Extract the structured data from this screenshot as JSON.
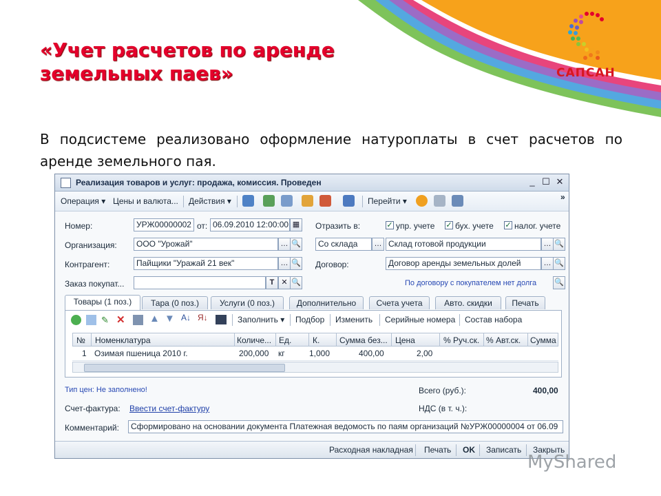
{
  "slide": {
    "title_line1": "«Учет расчетов по аренде",
    "title_line2": "земельных паев»",
    "subtitle": "В подсистеме реализовано оформление натуроплаты в счет расчетов по аренде земельного пая.",
    "logo_text": "САПСАН",
    "watermark": "MyShared"
  },
  "window": {
    "title": "Реализация товаров и услуг: продажа, комиссия. Проведен",
    "controls": {
      "minimize": "_",
      "maximize": "☐",
      "close": "✕"
    },
    "toolbar": {
      "operation": "Операция ▾",
      "prices": "Цены и валюта...",
      "actions": "Действия ▾",
      "goto": "Перейти ▾",
      "more": "»"
    },
    "fields": {
      "number_label": "Номер:",
      "number_value": "УРЖ00000002",
      "from_label": "от:",
      "date_value": "06.09.2010 12:00:00",
      "reflect_label": "Отразить в:",
      "chk_mgmt": "упр. учете",
      "chk_acc": "бух. учете",
      "chk_tax": "налог. учете",
      "org_label": "Организация:",
      "org_value": "ООО \"Урожай\"",
      "from_stock": "Со склада",
      "warehouse_value": "Склад готовой продукции",
      "contractor_label": "Контрагент:",
      "contractor_value": "Пайщики \"Уражай 21 век\"",
      "contract_label": "Договор:",
      "contract_value": "Договор аренды земельных долей",
      "order_label": "Заказ покупат...",
      "order_value": "",
      "order_hint": "По договору с покупателем нет долга"
    },
    "tabs": [
      "Товары (1 поз.)",
      "Тара (0 поз.)",
      "Услуги (0 поз.)",
      "Дополнительно",
      "Счета учета",
      "Авто. скидки",
      "Печать"
    ],
    "grid_toolbar": {
      "fill": "Заполнить ▾",
      "select": "Подбор",
      "change": "Изменить",
      "serials": "Серийные номера",
      "set": "Состав набора"
    },
    "grid_headers": [
      "№",
      "Номенклатура",
      "Количе...",
      "Ед.",
      "К.",
      "Сумма без...",
      "Цена",
      "% Руч.ск.",
      "% Авт.ск.",
      "Сумма"
    ],
    "grid_rows": [
      {
        "num": "1",
        "name": "Озимая пшеница 2010 г.",
        "qty": "200,000",
        "unit": "кг",
        "coef": "1,000",
        "sum_wo": "400,00",
        "price": "2,00"
      }
    ],
    "footer": {
      "price_type": "Тип цен: Не заполнено!",
      "total_label": "Всего (руб.):",
      "total_value": "400,00",
      "invoice_label": "Счет-фактура:",
      "invoice_link": "Ввести счет-фактуру",
      "vat_label": "НДС (в т. ч.):",
      "comment_label": "Комментарий:",
      "comment_value": "Сформировано на основании документа Платежная ведомость по паям организаций №УРЖ00000004 от 06.09"
    },
    "statusbar": {
      "waybill": "Расходная накладная",
      "print": "Печать",
      "ok": "OK",
      "save": "Записать",
      "close": "Закрыть"
    }
  },
  "colors": {
    "title_red": "#e4002b",
    "logo_red": "#d8161f"
  }
}
